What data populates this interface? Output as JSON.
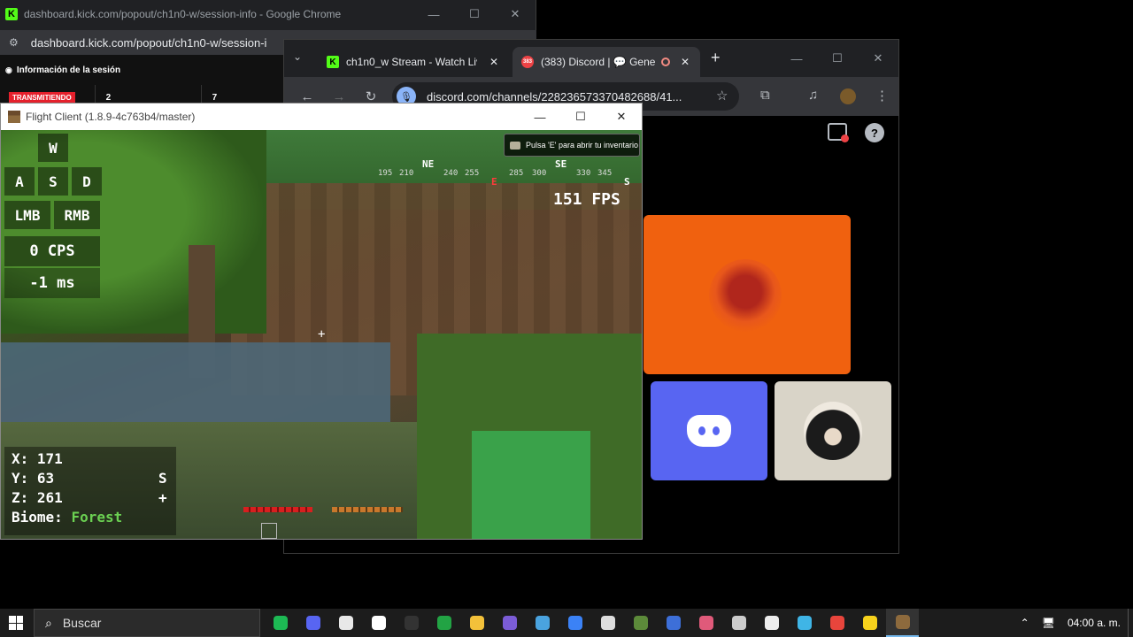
{
  "kick_window": {
    "title": "dashboard.kick.com/popout/ch1n0-w/session-info - Google Chrome",
    "url": "dashboard.kick.com/popout/ch1n0-w/session-i",
    "session_heading": "Información de la sesión",
    "live_badge": "TRANSMITIENDO",
    "stat_1": "2",
    "stat_2": "7",
    "controls": {
      "minimize": "—",
      "maximize": "☐",
      "close": "✕"
    }
  },
  "discord_window": {
    "tabs": [
      {
        "label": "ch1n0_w Stream - Watch Liv",
        "close": "✕"
      },
      {
        "label": "(383) Discord | 💬 Gene",
        "close": "✕"
      }
    ],
    "tab_search": "⌄",
    "new_tab": "+",
    "url": "discord.com/channels/228236573370482688/41...",
    "nav": {
      "back": "←",
      "forward": "→",
      "reload": "↻"
    },
    "toolbar_icons": {
      "bookmark": "☆",
      "extensions": "⧉",
      "media": "♫",
      "menu": "⋮"
    },
    "help": "?",
    "mic": "🎙",
    "controls": {
      "minimize": "—",
      "maximize": "☐",
      "close": "✕"
    },
    "accent_orange": "#f0610f",
    "accent_blurple": "#5865f2"
  },
  "mc_window": {
    "title": "Flight Client (1.8.9-4c763b4/master)",
    "controls": {
      "minimize": "—",
      "maximize": "☐",
      "close": "✕"
    },
    "toast": "Pulsa 'E' para abrir tu inventario",
    "keys": {
      "w": "W",
      "a": "A",
      "s": "S",
      "d": "D",
      "lmb": "LMB",
      "rmb": "RMB"
    },
    "cps": "0 CPS",
    "ping": "-1 ms",
    "fps": "151 FPS",
    "compass": {
      "ne": "NE",
      "se": "SE",
      "e": "E",
      "s": "S",
      "t195": "195",
      "t210": "210",
      "t240": "240",
      "t255": "255",
      "t285": "285",
      "t300": "300",
      "t330": "330",
      "t345": "345"
    },
    "crosshair": "+",
    "coords": {
      "x": "X: 171",
      "y": "Y: 63",
      "z": "Z: 261",
      "biome_label": "Biome: ",
      "biome_value": "Forest",
      "facing": "S",
      "facing_sign": "+"
    }
  },
  "taskbar": {
    "search_placeholder": "Buscar",
    "search_icon": "⌕",
    "clock": "04:00 a. m.",
    "tray": {
      "chevron": "⌃",
      "network": "🖥"
    },
    "apps": [
      {
        "name": "spotify",
        "color": "#1db954"
      },
      {
        "name": "discord",
        "color": "#5865f2"
      },
      {
        "name": "app-white",
        "color": "#e8e8e8"
      },
      {
        "name": "clock-app",
        "color": "#ffffff"
      },
      {
        "name": "app-dark",
        "color": "#333333"
      },
      {
        "name": "xbox",
        "color": "#22a344"
      },
      {
        "name": "file-explorer",
        "color": "#f3c13a"
      },
      {
        "name": "app-purple",
        "color": "#7b5cd6"
      },
      {
        "name": "store",
        "color": "#4aa3df"
      },
      {
        "name": "copilot",
        "color": "#3b82f6"
      },
      {
        "name": "checkmark",
        "color": "#dddddd"
      },
      {
        "name": "minecraft",
        "color": "#5c8a3a"
      },
      {
        "name": "app-blue",
        "color": "#3d6fd8"
      },
      {
        "name": "app-pink",
        "color": "#e05a7a"
      },
      {
        "name": "obs",
        "color": "#cccccc"
      },
      {
        "name": "app-light",
        "color": "#eeeeee"
      },
      {
        "name": "app-cyan",
        "color": "#3fb5e6"
      },
      {
        "name": "chrome",
        "color": "#e8453c"
      },
      {
        "name": "app-yellow",
        "color": "#f7d21c"
      },
      {
        "name": "flight-client",
        "color": "#8d6a3d"
      }
    ]
  }
}
